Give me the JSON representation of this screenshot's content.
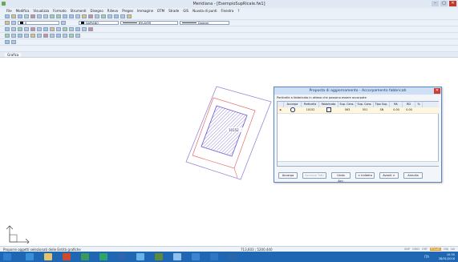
{
  "window": {
    "title": "Meridiana - [EsempioSupRicale.fw1]",
    "controls": [
      "–",
      "▢",
      "✕"
    ]
  },
  "menubar": {
    "items": [
      "File",
      "Modifica",
      "Visualizza",
      "Formato",
      "Strumenti",
      "Disegno",
      "Rilievo",
      "Pregeo",
      "Immagine",
      "DTM",
      "Strade",
      "GIS",
      "Nuvola di punti",
      "Finestra",
      "?"
    ]
  },
  "toolbar": {
    "layer_value": "0",
    "color_value": "DAPIANO",
    "linetype_value": "BYLAYER",
    "lineweight_value": "Dalayer"
  },
  "tabs": {
    "drawing": "Grafica"
  },
  "canvas": {
    "parcel_label": "10152"
  },
  "dialog": {
    "title": "Proposta di aggiornamento - Accorpamento fabbricati",
    "close": "✕",
    "instruction": "Particelle a fabbricato in attesa che possono essere accorpate",
    "columns": [
      "",
      "Accorpa",
      "Particella",
      "Fabbricato",
      "Sup. Cens.",
      "Sup. Cons.",
      "Tipo Sup.",
      "RA",
      "RD",
      "%"
    ],
    "row": {
      "marker": "▶",
      "accorpa": "",
      "particella": "10152",
      "fabbricato": "",
      "sup_cens": "563",
      "sup_cons": "551",
      "tipo_sup": "SN",
      "ra": "0.00",
      "rd": "0.00",
      "pct": ""
    },
    "buttons": {
      "accorpa": "Accorpa",
      "accorpa_tutti": "Accorpa Tutti",
      "undo": "Undo Acc.",
      "indietro": "< Indietro",
      "avanti": "Avanti >",
      "annulla": "Annulla"
    }
  },
  "status": {
    "message": "Proporre oggetti selezionati delle Entità grafiche",
    "coords": "713,603 ; 5200.440",
    "flags": [
      "SNP",
      "GRID",
      "ORT",
      "POLAR",
      "OBJ",
      "LW"
    ],
    "active_flag": "POLAR"
  },
  "taskbar": {
    "time": "10:35",
    "date": "28/01/2016",
    "lang": "ITA"
  },
  "colors": {
    "dialog_title_bg": "#cfe0f5",
    "taskbar": "#1f67b3",
    "hatch": "#7e6fd1",
    "boundary": "#e56b6b",
    "parcel_outline": "#7a5fd0"
  }
}
